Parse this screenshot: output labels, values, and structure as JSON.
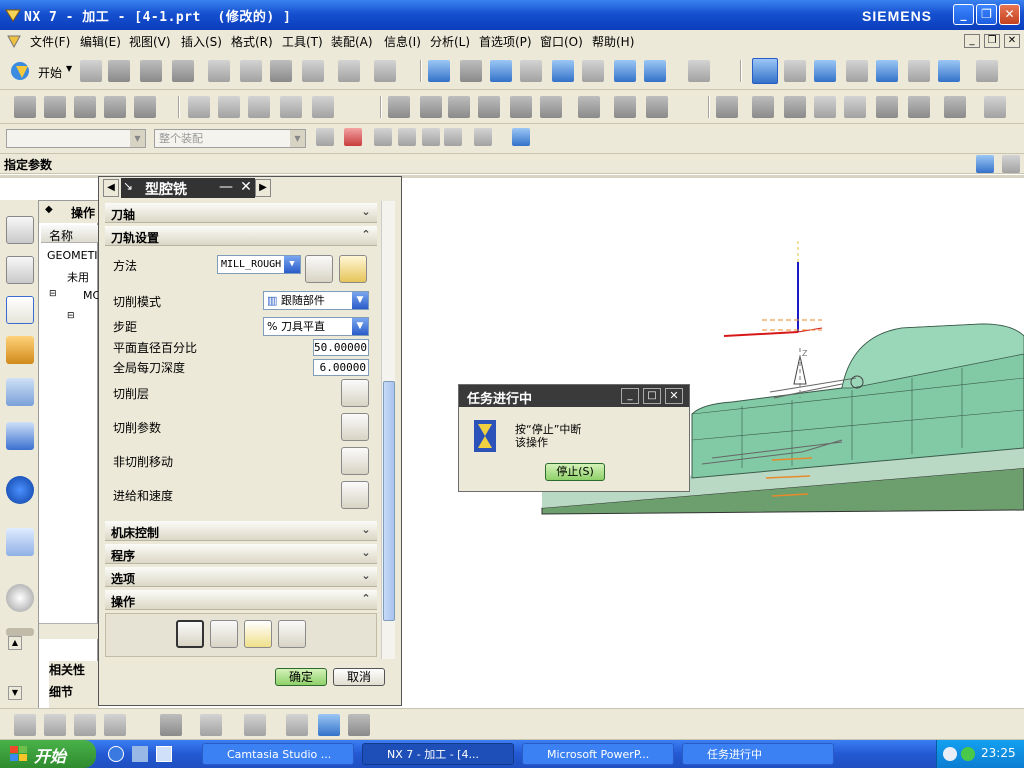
{
  "window": {
    "title": "NX 7 - 加工 - [4-1.prt  (修改的) ]",
    "brand": "SIEMENS",
    "min": "_",
    "restore": "❐",
    "close": "✕"
  },
  "menu": [
    "文件(F)",
    "编辑(E)",
    "视图(V)",
    "插入(S)",
    "格式(R)",
    "工具(T)",
    "装配(A)",
    "信息(I)",
    "分析(L)",
    "首选项(P)",
    "窗口(O)",
    "帮助(H)"
  ],
  "toolbar": {
    "start_label": "开始",
    "filter_placeholder": "",
    "assembly_placeholder": "整个装配"
  },
  "cue_line": {
    "text": "指定参数"
  },
  "nav": {
    "header": "操作",
    "col_name": "名称",
    "rows": [
      "GEOMETI",
      "未用",
      "MC"
    ],
    "bottom": [
      "相关性",
      "细节"
    ]
  },
  "dialog": {
    "title": "型腔铣",
    "sections": {
      "tool_axis": "刀轴",
      "path_settings": "刀轨设置",
      "machine_control": "机床控制",
      "program": "程序",
      "options": "选项",
      "actions": "操作"
    },
    "fields": {
      "method_label": "方法",
      "method_value": "MILL_ROUGH",
      "cut_mode_label": "切削模式",
      "cut_mode_value": "跟随部件",
      "stepover_label": "步距",
      "stepover_value": "% 刀具平直",
      "percent_label": "平面直径百分比",
      "percent_value": "50.00000",
      "depth_label": "全局每刀深度",
      "depth_value": "6.00000",
      "cut_levels_label": "切削层",
      "cut_params_label": "切削参数",
      "noncut_label": "非切削移动",
      "feeds_label": "进给和速度"
    },
    "ok": "确定",
    "cancel": "取消"
  },
  "popup": {
    "title": "任务进行中",
    "message_line1": "按“停止”中断",
    "message_line2": "该操作",
    "stop": "停止(S)"
  },
  "taskbar": {
    "start": "开始",
    "tasks": [
      "Camtasia Studio ...",
      "NX 7 - 加工 - [4...",
      "Microsoft PowerP...",
      "任务进行中"
    ],
    "clock": "23:25"
  },
  "colors": {
    "titlebar": "#1651d0",
    "model": "#7fc7a5",
    "ok_green": "#9fd87a"
  }
}
